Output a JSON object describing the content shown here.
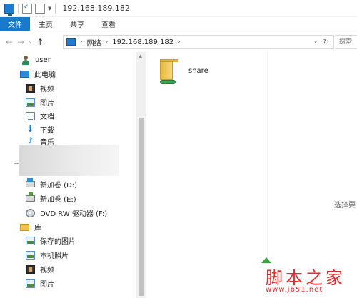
{
  "window": {
    "title": "192.168.189.182"
  },
  "ribbon": {
    "tabs": [
      "文件",
      "主页",
      "共享",
      "查看"
    ]
  },
  "address": {
    "segments": [
      "网络",
      "192.168.189.182"
    ],
    "search_placeholder": "搜索"
  },
  "nav_pane": {
    "items": [
      {
        "label": "user",
        "icon": "user-icon"
      },
      {
        "label": "此电脑",
        "icon": "computer-icon"
      },
      {
        "label": "视频",
        "icon": "video-folder-icon"
      },
      {
        "label": "图片",
        "icon": "pictures-folder-icon"
      },
      {
        "label": "文档",
        "icon": "documents-folder-icon"
      },
      {
        "label": "下载",
        "icon": "download-arrow-icon"
      },
      {
        "label": "音乐",
        "icon": "music-note-icon"
      },
      {
        "label": "新加卷 (D:)",
        "icon": "drive-icon"
      },
      {
        "label": "新加卷 (E:)",
        "icon": "drive-icon"
      },
      {
        "label": "DVD RW 驱动器 (F:)",
        "icon": "dvd-drive-icon"
      },
      {
        "label": "库",
        "icon": "library-icon"
      },
      {
        "label": "保存的图片",
        "icon": "pictures-folder-icon"
      },
      {
        "label": "本机照片",
        "icon": "pictures-folder-icon"
      },
      {
        "label": "视频",
        "icon": "video-folder-icon"
      },
      {
        "label": "图片",
        "icon": "pictures-folder-icon"
      }
    ]
  },
  "content": {
    "items": [
      {
        "label": "share",
        "icon": "shared-folder-icon"
      }
    ],
    "preview_hint": "选择要"
  },
  "watermark": {
    "text": "脚本之家",
    "url": "www.jb51.net"
  },
  "colors": {
    "accent": "#1979ca",
    "watermark": "#e22b2b"
  }
}
